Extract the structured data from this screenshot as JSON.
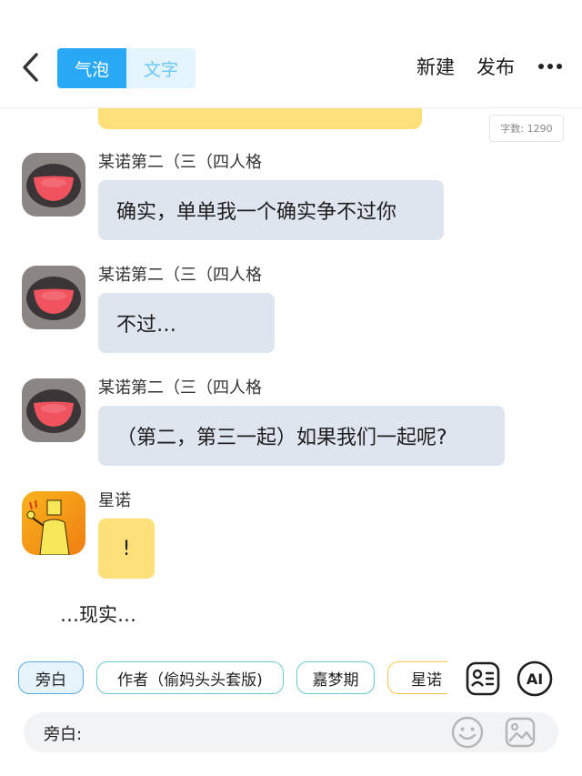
{
  "header": {
    "tabs": [
      {
        "label": "气泡",
        "active": true
      },
      {
        "label": "文字",
        "active": false
      }
    ],
    "actions": {
      "new": "新建",
      "publish": "发布"
    }
  },
  "word_count": "字数: 1290",
  "messages": [
    {
      "sender": "某诺第二（三（四人格",
      "text": "确实，单单我一个确实争不过你",
      "avatar": "red-smile-avatar"
    },
    {
      "sender": "某诺第二（三（四人格",
      "text": "不过…",
      "avatar": "red-smile-avatar"
    },
    {
      "sender": "某诺第二（三（四人格",
      "text": "（第二，第三一起）如果我们一起呢?",
      "avatar": "red-smile-avatar"
    },
    {
      "sender": "星诺",
      "text": "!",
      "avatar": "yellow-figure-avatar"
    }
  ],
  "narration": "…现实…",
  "roles": [
    {
      "label": "旁白",
      "selected": true
    },
    {
      "label": "作者（偷妈头头套版)",
      "selected": false
    },
    {
      "label": "嘉梦期",
      "selected": false
    },
    {
      "label": "星诺",
      "selected": false
    }
  ],
  "tools": {
    "ai": "AI"
  },
  "input": {
    "label": "旁白:",
    "value": ""
  },
  "colors": {
    "accent": "#29a9f5",
    "bubble_grey": "#dfe5ee",
    "bubble_yellow": "#fde07a",
    "chip_blue": "#5aaee0",
    "chip_teal": "#67c9d3",
    "chip_gold": "#f5c44a"
  }
}
